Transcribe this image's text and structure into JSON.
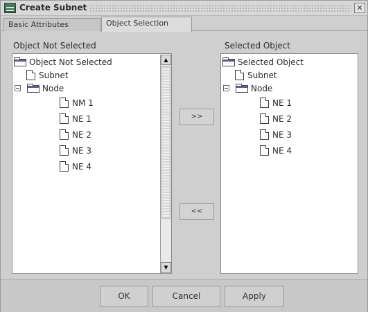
{
  "window": {
    "title": "Create Subnet",
    "close_glyph": "✕"
  },
  "tabs": [
    {
      "label": "Basic Attributes",
      "active": false
    },
    {
      "label": "Object Selection",
      "active": true
    }
  ],
  "left_panel": {
    "label": "Object Not Selected",
    "root": "Object Not Selected",
    "items": {
      "subnet": "Subnet",
      "node": "Node",
      "n1": "NM 1",
      "n2": "NE 1",
      "n3": "NE 2",
      "n4": "NE 3",
      "n5": "NE 4"
    }
  },
  "right_panel": {
    "label": "Selected Object",
    "root": "Selected Object",
    "items": {
      "subnet": "Subnet",
      "node": "Node",
      "n1": "NE 1",
      "n2": "NE 2",
      "n3": "NE 3",
      "n4": "NE 4"
    }
  },
  "buttons": {
    "add": ">>",
    "remove": "<<",
    "ok": "OK",
    "cancel": "Cancel",
    "apply": "Apply"
  },
  "scrollbar": {
    "up": "▲",
    "down": "▼"
  },
  "icons": {
    "app": "network-app-icon",
    "folder": "folder-icon",
    "document": "document-icon",
    "collapse": "minus-icon",
    "close": "close-icon"
  },
  "colors": {
    "window_bg": "#cfcfcf",
    "folder_band": "#5e5e8c",
    "list_bg": "#ffffff"
  }
}
